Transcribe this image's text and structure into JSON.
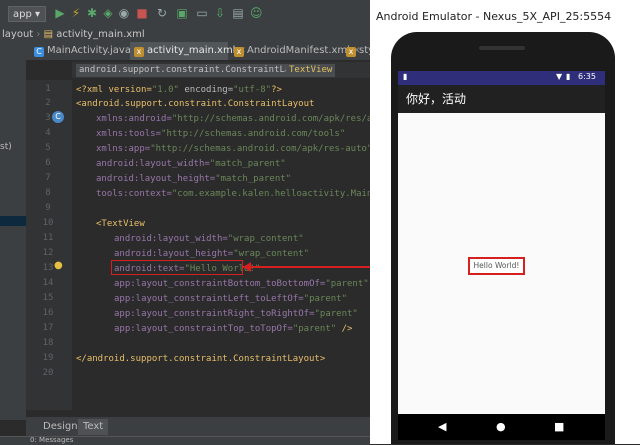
{
  "ide": {
    "run_config": "app",
    "breadcrumb": [
      "layout",
      "activity_main.xml"
    ],
    "tabs": [
      {
        "label": "MainActivity.java",
        "active": false
      },
      {
        "label": "activity_main.xml",
        "active": true
      },
      {
        "label": "AndroidManifest.xml",
        "active": false
      },
      {
        "label": "styl",
        "active": false
      }
    ],
    "left_partial": "st)",
    "tag_breadcrumbs": [
      "android.support.constraint.ConstraintLayout",
      "TextView"
    ],
    "line_numbers": [
      "1",
      "2",
      "3",
      "4",
      "5",
      "6",
      "7",
      "8",
      "9",
      "10",
      "11",
      "12",
      "13",
      "14",
      "15",
      "16",
      "17",
      "18",
      "19",
      "20"
    ],
    "code": {
      "l1_a": "<?xml version=",
      "l1_b": "\"1.0\"",
      "l1_c": " encoding=",
      "l1_d": "\"utf-8\"",
      "l1_e": "?>",
      "l2": "<android.support.constraint.ConstraintLayout",
      "l3_ns": "xmlns:android=",
      "l3_v": "\"http://schemas.android.com/apk/res/android\"",
      "l4_ns": "xmlns:tools=",
      "l4_v": "\"http://schemas.android.com/tools\"",
      "l5_ns": "xmlns:app=",
      "l5_v": "\"http://schemas.android.com/apk/res-auto\"",
      "l6_a": "android:layout_width=",
      "l6_v": "\"match_parent\"",
      "l7_a": "android:layout_height=",
      "l7_v": "\"match_parent\"",
      "l8_a": "tools:context=",
      "l8_v": "\"com.example.kalen.helloactivity.MainActivit",
      "l10": "<TextView",
      "l11_a": "android:layout_width=",
      "l11_v": "\"wrap_content\"",
      "l12_a": "android:layout_height=",
      "l12_v": "\"wrap_content\"",
      "l13_a": "android:text=",
      "l13_v": "\"Hello World!\"",
      "l14_a": "app:layout_constraintBottom_toBottomOf=",
      "l14_v": "\"parent\"",
      "l15_a": "app:layout_constraintLeft_toLeftOf=",
      "l15_v": "\"parent\"",
      "l16_a": "app:layout_constraintRight_toRightOf=",
      "l16_v": "\"parent\"",
      "l17_a": "app:layout_constraintTop_toTopOf=",
      "l17_v": "\"parent\"",
      "l17_e": " />",
      "l19": "</android.support.constraint.ConstraintLayout>"
    },
    "bottom_tabs": [
      "Design",
      "Text"
    ],
    "bottom_status": "0: Messages"
  },
  "emulator": {
    "title": "Android Emulator - Nexus_5X_API_25:5554",
    "time": "6:35",
    "app_title": "你好，活动",
    "hello_text": "Hello World!"
  },
  "colors": {
    "highlight": "#d62020",
    "action_bar": "#212121",
    "status_bar": "#2e2e7a"
  }
}
